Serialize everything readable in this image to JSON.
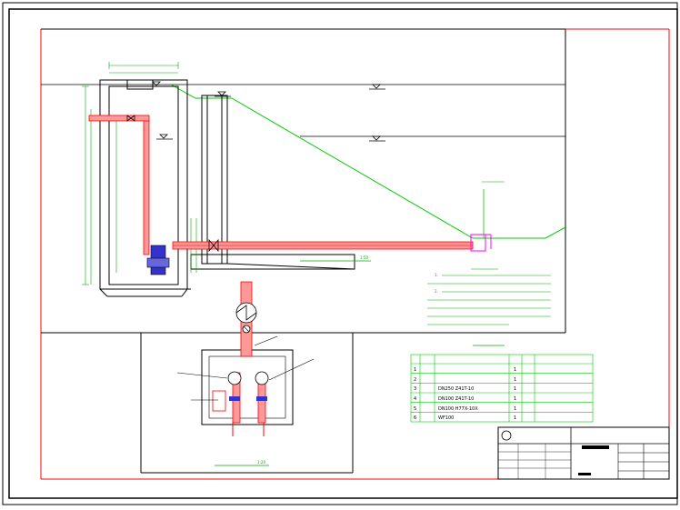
{
  "colors": {
    "background": "#ffffff",
    "frame": "#000000",
    "border_accent": "#ff0000",
    "structure": "#000000",
    "slope_line": "#00cc00",
    "dimension": "#00aa00",
    "pipe": "#ff0000",
    "pipe_fill": "#ff9999",
    "fitting": "#ff00ff",
    "pump": "#3333cc",
    "notes_text": "#00aa00",
    "table_line": "#00cc00",
    "level_mark": "#0000ff"
  },
  "icons": [
    "pump-icon",
    "valve-icon",
    "flowmeter-icon",
    "pressure-gauge-icon",
    "water-level-icon"
  ],
  "main_view": {
    "pipe_caption": "1:50",
    "plan_caption": "1:20"
  },
  "notes": {
    "lines": [
      "1.",
      "2."
    ]
  },
  "equipment_table": {
    "rows": [
      {
        "no": "1",
        "spec": "",
        "qty": "1"
      },
      {
        "no": "2",
        "spec": "",
        "qty": "1"
      },
      {
        "no": "3",
        "spec": "DN250 Z41T-10",
        "qty": "1"
      },
      {
        "no": "4",
        "spec": "DN100 Z41T-10",
        "qty": "1"
      },
      {
        "no": "5",
        "spec": "DN100 H77X-10X",
        "qty": "1"
      },
      {
        "no": "6",
        "spec": "WF100",
        "qty": "1"
      }
    ]
  },
  "title_block": {
    "company": "",
    "project": ""
  }
}
